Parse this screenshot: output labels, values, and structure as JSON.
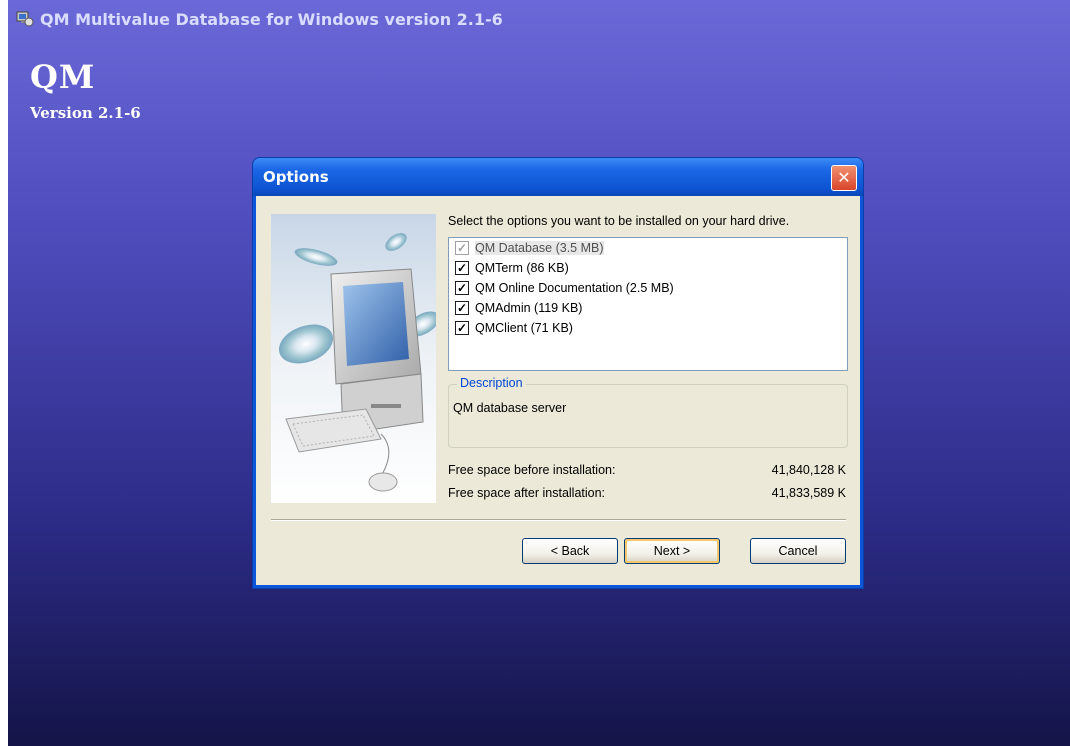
{
  "window": {
    "title": "QM Multivalue Database for Windows version 2.1-6",
    "brand": "QM",
    "version": "Version 2.1-6"
  },
  "dialog": {
    "title": "Options",
    "prompt": "Select the options you want to be installed on your hard drive.",
    "options": [
      {
        "label": "QM Database (3.5 MB)",
        "checked": true,
        "disabled": true,
        "selected": true
      },
      {
        "label": "QMTerm (86 KB)",
        "checked": true,
        "disabled": false
      },
      {
        "label": "QM Online Documentation (2.5 MB)",
        "checked": true,
        "disabled": false
      },
      {
        "label": "QMAdmin (119 KB)",
        "checked": true,
        "disabled": false
      },
      {
        "label": "QMClient (71 KB)",
        "checked": true,
        "disabled": false
      }
    ],
    "description_label": "Description",
    "description_text": "QM database server",
    "space_before_label": "Free space before installation:",
    "space_before_value": "41,840,128 K",
    "space_after_label": "Free space after installation:",
    "space_after_value": "41,833,589 K",
    "buttons": {
      "back": "< Back",
      "next": "Next >",
      "cancel": "Cancel"
    }
  },
  "colors": {
    "desktop_top": "#6b69d8",
    "desktop_bottom": "#141448",
    "titlebar": "#0c57d9",
    "dialog_body": "#ece9d8"
  }
}
